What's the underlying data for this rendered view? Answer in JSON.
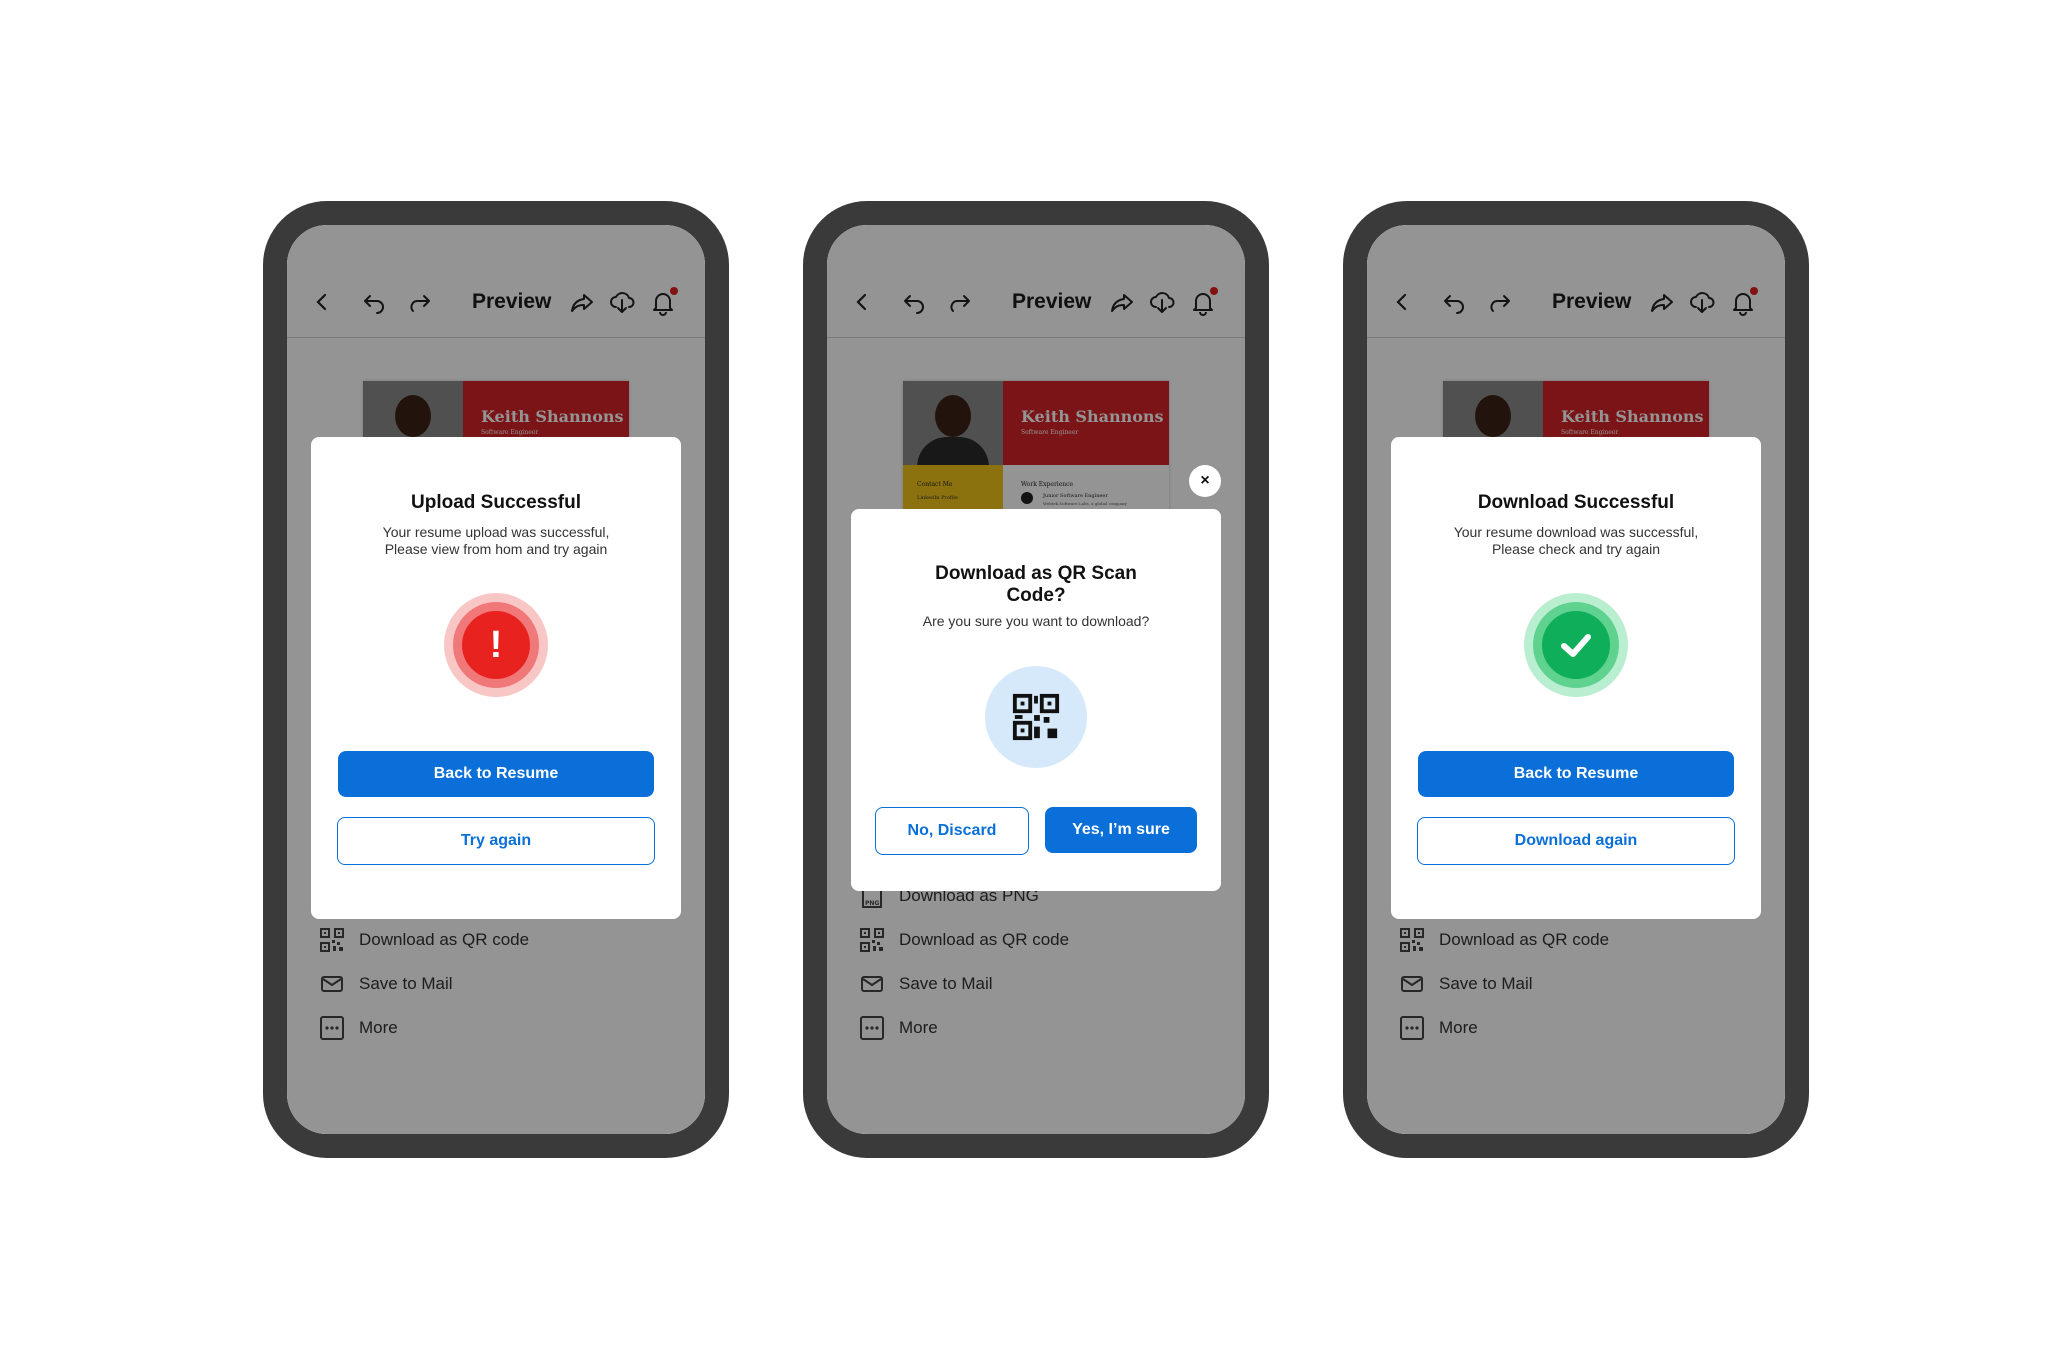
{
  "appbar": {
    "title": "Preview"
  },
  "resume": {
    "name": "Keith Shannons",
    "role": "Software Engineer",
    "contact_label": "Contact Me",
    "contact_line": "LinkedIn Profile",
    "work_label": "Work Experience",
    "work_title": "Junior Software Engineer",
    "work_company": "Webtek Software Labs, a global company"
  },
  "options": {
    "png": "Download as PNG",
    "qr": "Download as QR code",
    "mail": "Save to Mail",
    "more": "More"
  },
  "screen1": {
    "title": "Upload Successful",
    "subtitle_line1": "Your resume upload was successful,",
    "subtitle_line2": "Please view from hom and try again",
    "icon_glyph": "!",
    "primary_label": "Back to Resume",
    "secondary_label": "Try again"
  },
  "screen2": {
    "title_line1": "Download as QR Scan",
    "title_line2": "Code?",
    "subtitle": "Are you sure you want to download?",
    "close_glyph": "×",
    "cancel_label": "No, Discard",
    "confirm_label": "Yes, I’m sure"
  },
  "screen3": {
    "title": "Download Successful",
    "subtitle_line1": "Your resume download was successful,",
    "subtitle_line2": "Please check and try again",
    "primary_label": "Back to Resume",
    "secondary_label": "Download again"
  },
  "colors": {
    "accent": "#0a6fd8",
    "error": "#e8221f",
    "success": "#0fae5a",
    "phone_frame": "#3a3a3a",
    "resume_red": "#d42427",
    "resume_yellow": "#f0c419"
  }
}
